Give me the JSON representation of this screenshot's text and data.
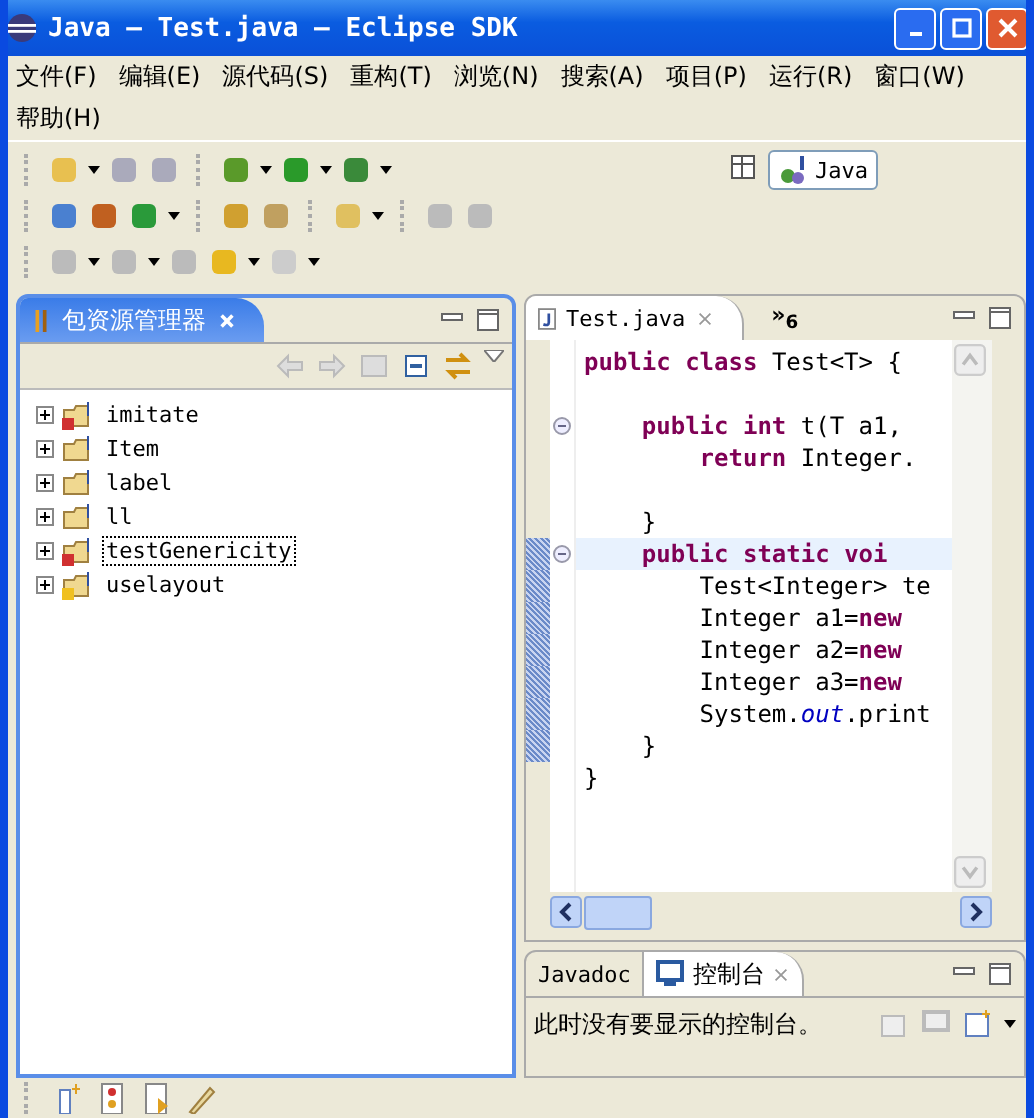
{
  "window": {
    "title": "Java — Test.java — Eclipse SDK"
  },
  "menu": [
    "文件(F)",
    "编辑(E)",
    "源代码(S)",
    "重构(T)",
    "浏览(N)",
    "搜索(A)",
    "项目(P)",
    "运行(R)",
    "窗口(W)",
    "帮助(H)"
  ],
  "perspective": {
    "label": "Java",
    "selected": true
  },
  "explorer": {
    "title": "包资源管理器",
    "selected": true,
    "items": [
      {
        "name": "imitate",
        "kind": "error",
        "expanded": false,
        "selected": false
      },
      {
        "name": "Item",
        "kind": "plain",
        "expanded": false,
        "selected": false
      },
      {
        "name": "label",
        "kind": "plain",
        "expanded": false,
        "selected": false
      },
      {
        "name": "ll",
        "kind": "plain",
        "expanded": false,
        "selected": false
      },
      {
        "name": "testGenericity",
        "kind": "error",
        "expanded": false,
        "selected": true
      },
      {
        "name": "uselayout",
        "kind": "warning",
        "expanded": false,
        "selected": false
      }
    ]
  },
  "editor": {
    "tabs": [
      {
        "label": "Test.java",
        "selected": true
      }
    ],
    "overflow": "»",
    "overflow_count": "6",
    "lines": [
      {
        "fold": false,
        "current": false,
        "in_range": false,
        "tokens": [
          {
            "kind": "keyword",
            "text": "public "
          },
          {
            "kind": "keyword",
            "text": "class "
          },
          {
            "kind": "plain",
            "text": "Test<T> {"
          }
        ]
      },
      {
        "fold": false,
        "current": false,
        "in_range": false
      },
      {
        "fold": true,
        "current": false,
        "in_range": false,
        "tokens": [
          {
            "kind": "keyword",
            "text": "    public "
          },
          {
            "kind": "keyword",
            "text": "int "
          },
          {
            "kind": "plain",
            "text": "t(T a1,"
          }
        ]
      },
      {
        "fold": false,
        "current": false,
        "in_range": false,
        "tokens": [
          {
            "kind": "keyword",
            "text": "        return "
          },
          {
            "kind": "plain",
            "text": "Integer."
          }
        ]
      },
      {
        "fold": false,
        "current": false,
        "in_range": false
      },
      {
        "fold": false,
        "current": false,
        "in_range": false,
        "tokens": [
          {
            "kind": "plain",
            "text": "    }"
          }
        ]
      },
      {
        "fold": true,
        "current": true,
        "in_range": true,
        "tokens": [
          {
            "kind": "keyword",
            "text": "    public "
          },
          {
            "kind": "keyword",
            "text": "static "
          },
          {
            "kind": "keyword",
            "text": "voi"
          }
        ]
      },
      {
        "fold": false,
        "current": false,
        "in_range": true,
        "tokens": [
          {
            "kind": "plain",
            "text": "        Test<Integer> te"
          }
        ]
      },
      {
        "fold": false,
        "current": false,
        "in_range": true,
        "tokens": [
          {
            "kind": "plain",
            "text": "        Integer a1="
          },
          {
            "kind": "keyword",
            "text": "new"
          }
        ]
      },
      {
        "fold": false,
        "current": false,
        "in_range": true,
        "tokens": [
          {
            "kind": "plain",
            "text": "        Integer a2="
          },
          {
            "kind": "keyword",
            "text": "new"
          }
        ]
      },
      {
        "fold": false,
        "current": false,
        "in_range": true,
        "tokens": [
          {
            "kind": "plain",
            "text": "        Integer a3="
          },
          {
            "kind": "keyword",
            "text": "new"
          }
        ]
      },
      {
        "fold": false,
        "current": false,
        "in_range": true,
        "tokens": [
          {
            "kind": "plain",
            "text": "        System."
          },
          {
            "kind": "field",
            "text": "out"
          },
          {
            "kind": "plain",
            "text": ".print"
          }
        ]
      },
      {
        "fold": false,
        "current": false,
        "in_range": true,
        "tokens": [
          {
            "kind": "plain",
            "text": "    }"
          }
        ]
      },
      {
        "fold": false,
        "current": false,
        "in_range": false,
        "tokens": [
          {
            "kind": "plain",
            "text": "}"
          }
        ]
      }
    ]
  },
  "console": {
    "tabs": [
      {
        "label": "Javadoc",
        "selected": false,
        "icon": false
      },
      {
        "label": "控制台",
        "selected": true,
        "icon": true
      }
    ],
    "message": "此时没有要显示的控制台。"
  }
}
